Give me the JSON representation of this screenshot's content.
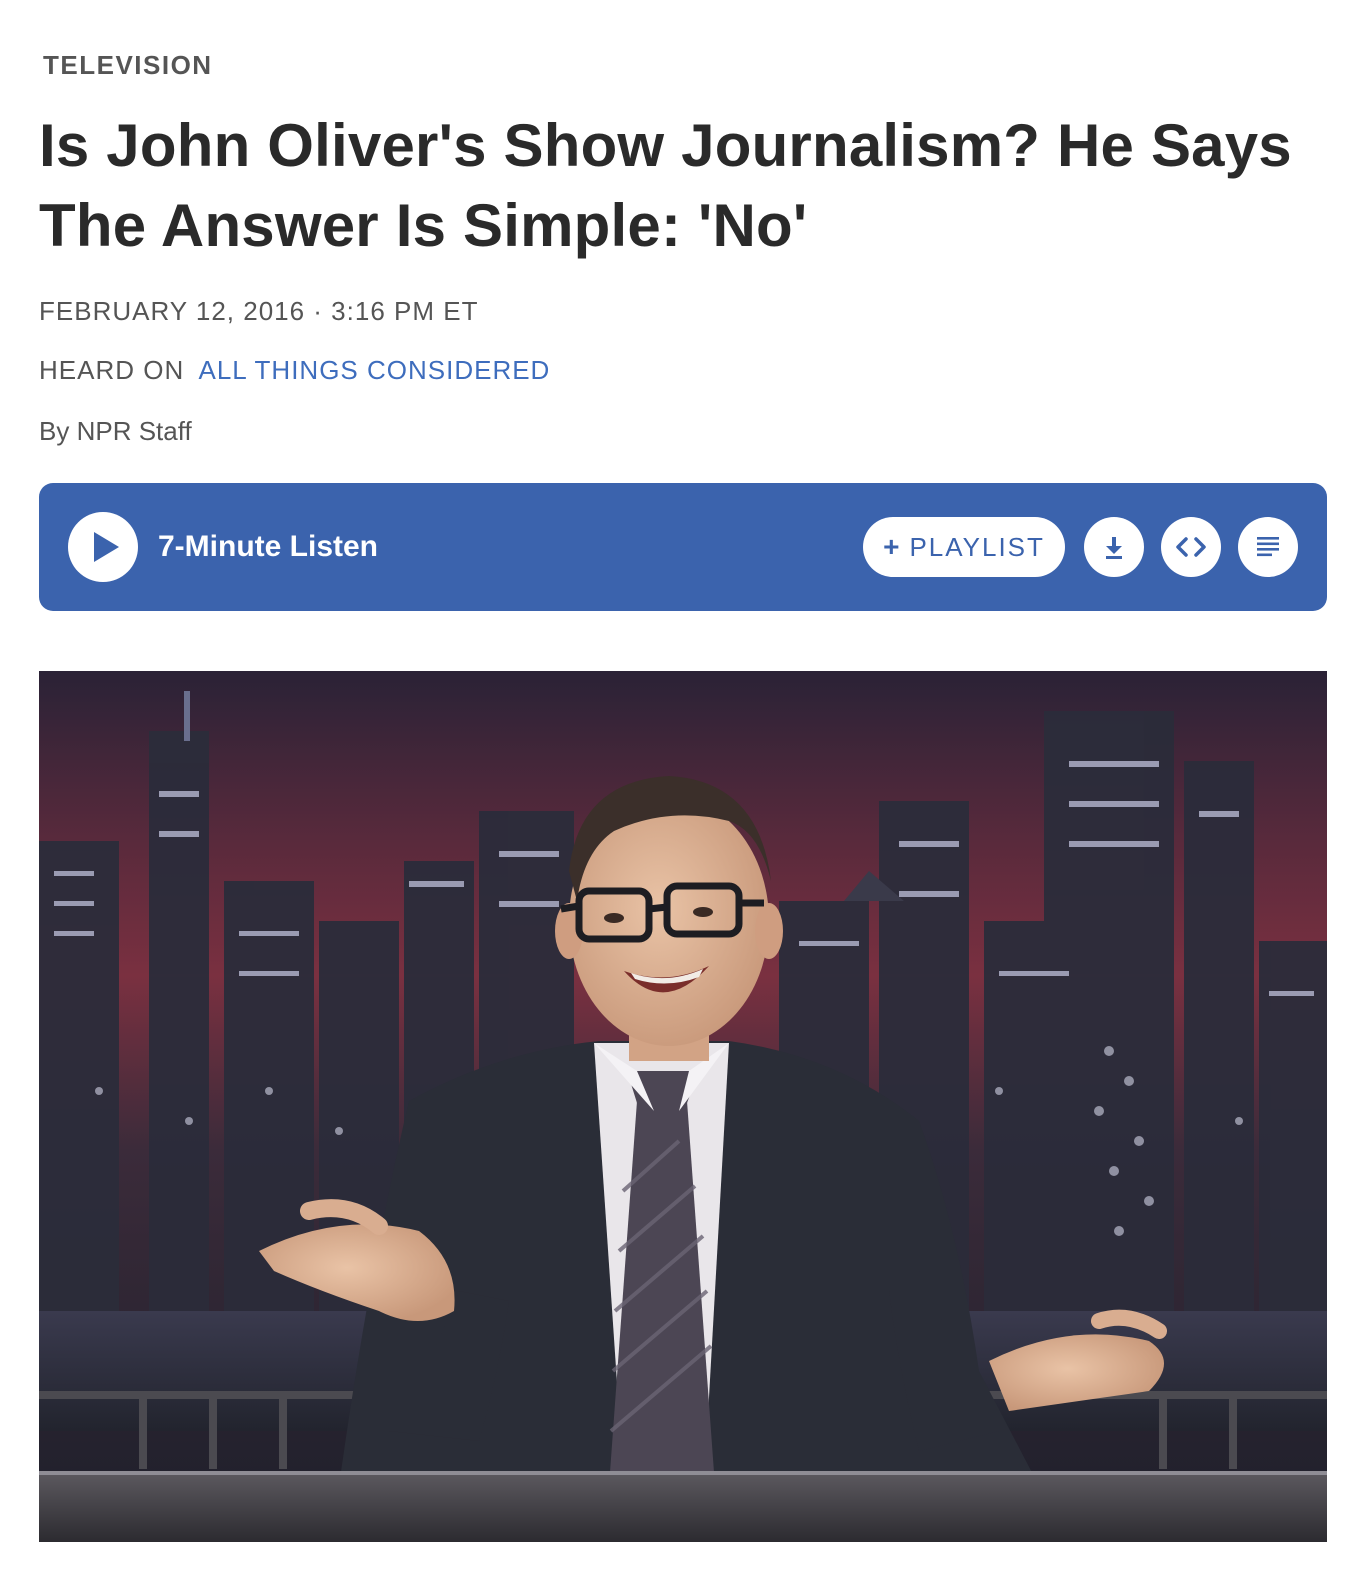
{
  "article": {
    "category": "TELEVISION",
    "headline": "Is John Oliver's Show Journalism? He Says The Answer Is Simple: 'No'",
    "date": "FEBRUARY 12, 2016 · 3:16 PM ET",
    "heard_on_prefix": "HEARD ON",
    "heard_on_show": "ALL THINGS CONSIDERED",
    "byline_prefix": "By",
    "author": "NPR Staff"
  },
  "player": {
    "listen_label": "7-Minute Listen",
    "playlist_label": "PLAYLIST",
    "playlist_plus": "+",
    "accent_color": "#3b63ad",
    "icons": {
      "play": "play-icon",
      "download": "download-icon",
      "embed": "embed-icon",
      "transcript": "transcript-icon"
    }
  },
  "colors": {
    "headline": "#2a2a2a",
    "meta": "#555555",
    "link": "#3e6dbd"
  }
}
